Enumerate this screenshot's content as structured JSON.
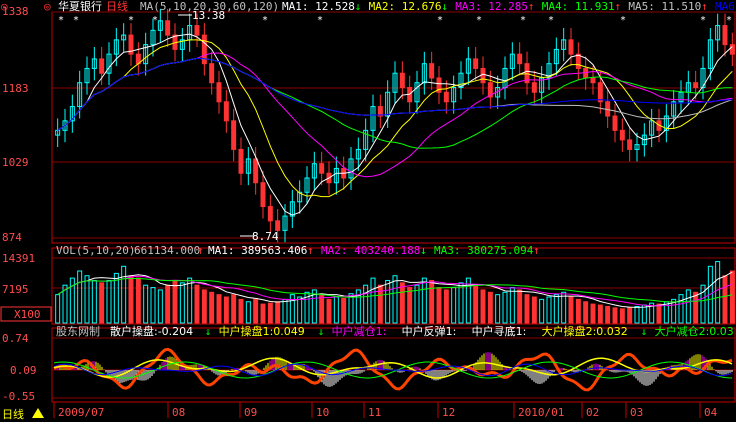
{
  "colors": {
    "bg": "#000000",
    "grid": "#8b0000",
    "axis": "#c00000",
    "up": "#00ffff",
    "down": "#ff3333",
    "white": "#ffffff",
    "yellow": "#ffff00",
    "magenta": "#ff00ff",
    "green": "#00ff00",
    "darkgreen": "#2e8b2e",
    "blue": "#0000ff",
    "gray": "#c0c0c0",
    "ticklabel": "#ff4d4d",
    "orange": "#ff4400"
  },
  "main_panel": {
    "stock_name": "华夏银行",
    "period": "日线",
    "ma_label": "MA(5,10,20,30,60,120)",
    "ma_values": [
      {
        "label": "MA1:",
        "value": "12.528",
        "arrow": "↓",
        "color": "#ffffff"
      },
      {
        "label": "MA2:",
        "value": "12.676",
        "arrow": "↓",
        "color": "#ffff00"
      },
      {
        "label": "MA3:",
        "value": "12.285",
        "arrow": "↑",
        "color": "#ff00ff"
      },
      {
        "label": "MA4:",
        "value": "11.931",
        "arrow": "↑",
        "color": "#00ff00"
      },
      {
        "label": "MA5:",
        "value": "11.510",
        "arrow": "↑",
        "color": "#c0c0c0"
      },
      {
        "label": "MA6:",
        "value": "",
        "arrow": "",
        "color": "#0000ff"
      }
    ],
    "y_ticks": [
      "1338",
      "1183",
      "1029",
      "874"
    ],
    "high_marker": "13.38",
    "low_marker": "8.74"
  },
  "vol_panel": {
    "title": "VOL(5,10,20)",
    "value": "661134.000",
    "arrow": "↑",
    "ma_values": [
      {
        "label": "MA1:",
        "value": "389563.406",
        "arrow": "↑",
        "color": "#ffffff"
      },
      {
        "label": "MA2:",
        "value": "403240.188",
        "arrow": "↓",
        "color": "#ff00ff"
      },
      {
        "label": "MA3:",
        "value": "380275.094",
        "arrow": "↑",
        "color": "#00ff00"
      }
    ],
    "y_ticks": [
      "14391",
      "7195"
    ],
    "unit": "X100"
  },
  "ind_panel": {
    "title": "股东网制",
    "items": [
      {
        "label": "散户操盘:",
        "value": "-0.204",
        "arrow": "↓",
        "color": "#ffffff"
      },
      {
        "label": "中户操盘1:",
        "value": "0.049",
        "arrow": "↓",
        "color": "#ffff00"
      },
      {
        "label": "中户减仓1:",
        "value": "",
        "arrow": "",
        "color": "#ff00ff"
      },
      {
        "label": "中户反弹1:",
        "value": "",
        "arrow": "",
        "color": "#ffffff"
      },
      {
        "label": "中户寻底1:",
        "value": "",
        "arrow": "",
        "color": "#ffffff"
      },
      {
        "label": "大户操盘2:",
        "value": "0.032",
        "arrow": "↓",
        "color": "#ffff00"
      },
      {
        "label": "大户减仓2:",
        "value": "0.03",
        "arrow": "",
        "color": "#00ff00"
      }
    ],
    "y_ticks": [
      "0.74",
      "0.09",
      "-0.55"
    ]
  },
  "x_axis": {
    "labels": [
      "2009/07",
      "08",
      "09",
      "10",
      "11",
      "12",
      "2010/01",
      "02",
      "03",
      "04"
    ]
  },
  "bottom_period": "日线",
  "chart_data": {
    "type": "candlestick",
    "ylim": [
      8.74,
      13.38
    ],
    "closes": [
      11.0,
      11.2,
      11.5,
      12.0,
      12.3,
      12.5,
      12.2,
      12.6,
      12.9,
      13.0,
      12.6,
      12.4,
      12.8,
      13.1,
      13.3,
      13.0,
      12.7,
      12.9,
      13.2,
      13.0,
      12.4,
      12.0,
      11.6,
      11.2,
      10.6,
      10.1,
      10.4,
      9.9,
      9.4,
      9.1,
      8.9,
      9.2,
      9.5,
      9.7,
      10.0,
      10.3,
      10.1,
      9.9,
      10.2,
      10.0,
      10.4,
      10.6,
      11.0,
      11.5,
      11.3,
      11.8,
      12.2,
      11.9,
      11.6,
      12.0,
      12.4,
      12.1,
      11.8,
      11.6,
      11.9,
      12.2,
      12.5,
      12.3,
      12.0,
      11.7,
      11.9,
      12.3,
      12.6,
      12.4,
      12.0,
      11.8,
      12.1,
      12.4,
      12.7,
      12.9,
      12.6,
      12.3,
      12.1,
      12.0,
      11.6,
      11.3,
      11.0,
      10.8,
      10.6,
      10.7,
      10.9,
      11.2,
      11.0,
      11.3,
      11.6,
      11.8,
      12.0,
      11.9,
      12.3,
      12.9,
      13.2,
      12.8,
      12.6
    ],
    "volumes": [
      6000,
      8000,
      9500,
      11000,
      10000,
      9000,
      8500,
      9000,
      10500,
      12000,
      10000,
      9500,
      8000,
      7500,
      7000,
      8000,
      9000,
      8500,
      9500,
      8000,
      7000,
      6500,
      6000,
      5500,
      6000,
      5000,
      4500,
      5000,
      4000,
      4200,
      4500,
      5000,
      6000,
      5500,
      6500,
      7000,
      6000,
      5000,
      5500,
      5200,
      6200,
      7000,
      8000,
      9500,
      8000,
      9000,
      10000,
      8500,
      7500,
      8000,
      9500,
      9000,
      7500,
      7000,
      7500,
      8500,
      9500,
      8000,
      7000,
      6500,
      6000,
      6500,
      7500,
      7000,
      6000,
      5500,
      5000,
      5500,
      6000,
      6500,
      5500,
      5000,
      4500,
      4000,
      3800,
      3500,
      3200,
      3000,
      3300,
      3500,
      3800,
      4200,
      4000,
      4500,
      5000,
      6000,
      7000,
      6500,
      8000,
      12000,
      13000,
      10000,
      11000
    ],
    "vol_ylim": [
      0,
      14391
    ]
  }
}
